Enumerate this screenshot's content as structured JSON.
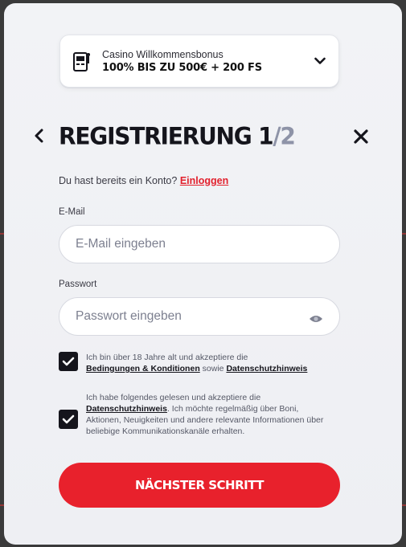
{
  "bonus": {
    "subtitle": "Casino Willkommensbonus",
    "title": "100% BIS ZU 500€ + 200 FS",
    "icon": "slot-machine-icon"
  },
  "header": {
    "title_main": "REGISTRIERUNG 1",
    "title_slash": "/2"
  },
  "login": {
    "question": "Du hast bereits ein Konto?",
    "link": "Einloggen"
  },
  "email": {
    "label": "E-Mail",
    "placeholder": "E-Mail eingeben",
    "value": ""
  },
  "password": {
    "label": "Passwort",
    "placeholder": "Passwort eingeben",
    "value": ""
  },
  "consent_age": {
    "checked": true,
    "text_1": "Ich bin über 18 Jahre alt und akzeptiere die",
    "link_terms": "Bedingungen & Konditionen",
    "text_2": "sowie",
    "link_privacy": "Datenschutzhinweis"
  },
  "consent_marketing": {
    "checked": true,
    "text_1": "Ich habe folgendes gelesen und akzeptiere die",
    "link_privacy": "Datenschutzhinweis",
    "text_2": ". Ich möchte regelmäßig über Boni, Aktionen, Neuigkeiten und andere relevante Informationen über beliebige Kommunikationskanäle erhalten."
  },
  "cta": {
    "label": "NÄCHSTER SCHRITT"
  },
  "colors": {
    "accent": "#e8212c",
    "dark": "#15151c",
    "muted_slash": "#8e93a7"
  }
}
